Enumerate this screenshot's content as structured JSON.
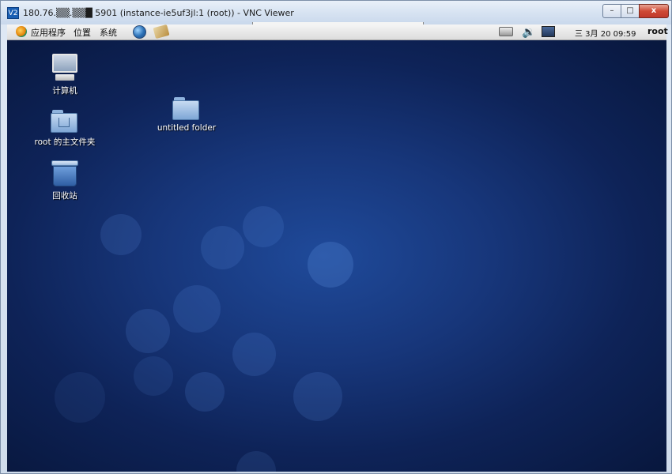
{
  "window": {
    "icon_label": "V2",
    "title": "180.76.▒▒.▒▒█ 5901 (instance-ie5uf3jl:1 (root)) - VNC Viewer",
    "min_label": "–",
    "max_label": "□",
    "close_label": "x"
  },
  "panel": {
    "menus": [
      "应用程序",
      "位置",
      "系统"
    ],
    "clock": "三  3月 20 09:59",
    "user": "root",
    "volume_glyph": "🔉"
  },
  "desktop": {
    "icons": [
      {
        "label": "计算机",
        "kind": "computer-icon"
      },
      {
        "label": "root 的主文件夹",
        "kind": "home-folder-icon"
      },
      {
        "label": "回收站",
        "kind": "trash-icon"
      },
      {
        "label": "untitled folder",
        "kind": "folder-icon"
      }
    ]
  },
  "colors": {
    "desktop_center": "#1f4a9a",
    "desktop_edge": "#08173d",
    "close_button": "#cf4a35"
  }
}
